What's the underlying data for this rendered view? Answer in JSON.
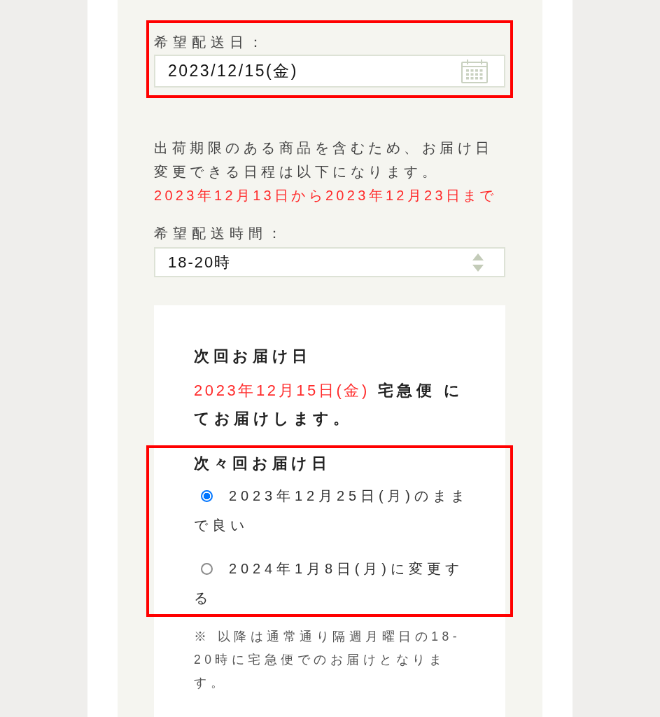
{
  "delivery_date": {
    "label": "希望配送日：",
    "value": "2023/12/15(金)",
    "highlighted": true
  },
  "notice": {
    "text": "出荷期限のある商品を含むため、お届け日変更できる日程は以下になります。",
    "date_range": "2023年12月13日から2023年12月23日まで"
  },
  "delivery_time": {
    "label": "希望配送時間：",
    "value": "18-20時"
  },
  "next_delivery": {
    "heading": "次回お届け日",
    "date": "2023年12月15日(金)",
    "message": "宅急便 にてお届けします。"
  },
  "following_delivery": {
    "heading": "次々回お届け日",
    "highlighted": true,
    "options": [
      {
        "label": "2023年12月25日(月)のままで良い",
        "selected": true
      },
      {
        "label": "2024年1月8日(月)に変更する",
        "selected": false
      }
    ]
  },
  "footnote": "※ 以降は通常通り隔週月曜日の18-20時に宅急便でのお届けとなります。"
}
